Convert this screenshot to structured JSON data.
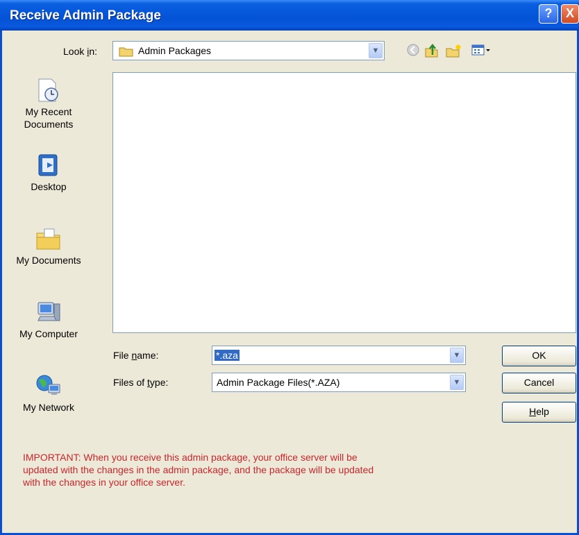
{
  "window": {
    "title": "Receive Admin Package"
  },
  "title_buttons": {
    "help": "?",
    "close": "X"
  },
  "look_in": {
    "label_pre": "Look ",
    "label_key": "i",
    "label_post": "n:",
    "value": "Admin Packages"
  },
  "toolbar_icons": [
    "back-icon",
    "up-folder-icon",
    "new-folder-icon",
    "view-menu-icon"
  ],
  "places": [
    {
      "label_line1": "My Recent",
      "label_line2": "Documents",
      "icon": "recent-documents-icon"
    },
    {
      "label_line1": "Desktop",
      "label_line2": "",
      "icon": "desktop-icon"
    },
    {
      "label_line1": "My Documents",
      "label_line2": "",
      "icon": "my-documents-icon"
    },
    {
      "label_line1": "My Computer",
      "label_line2": "",
      "icon": "my-computer-icon"
    },
    {
      "label_line1": "My Network",
      "label_line2": "",
      "icon": "my-network-icon"
    }
  ],
  "file_name": {
    "label_pre": "File ",
    "label_key": "n",
    "label_post": "ame:",
    "value": "*.aza"
  },
  "file_type": {
    "label_pre": "Files of ",
    "label_key": "t",
    "label_post": "ype:",
    "value": "Admin Package Files(*.AZA)"
  },
  "buttons": {
    "ok": "OK",
    "cancel": "Cancel",
    "help_key": "H",
    "help_rest": "elp"
  },
  "notice": {
    "line1": "IMPORTANT: When you receive this admin package, your office server will be",
    "line2": "updated with the changes in the admin package, and the package will be updated",
    "line3": "with the changes in your office server."
  },
  "colors": {
    "title_bar": "#0453d6",
    "notice_text": "#c8262c",
    "selection": "#316ac5"
  }
}
